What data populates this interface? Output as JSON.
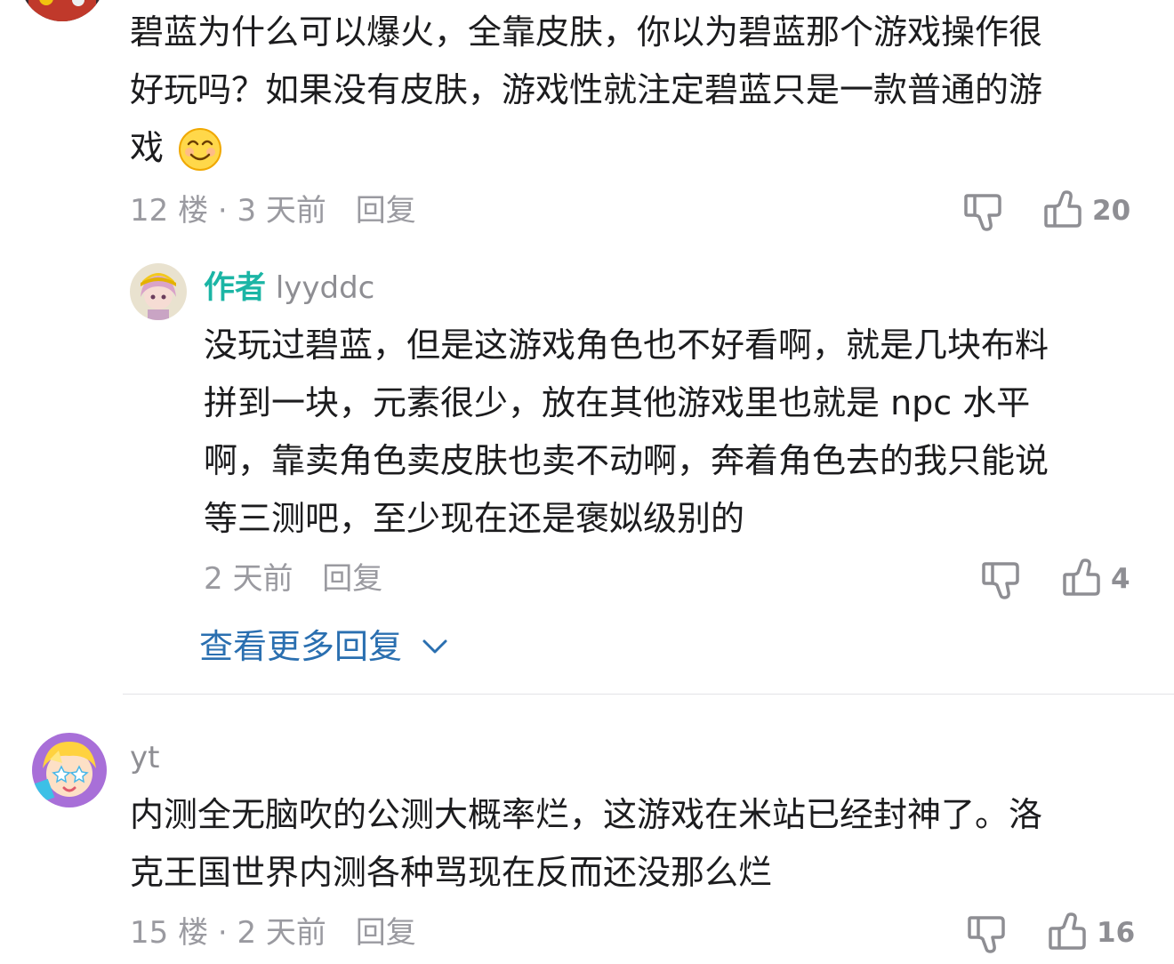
{
  "comment12": {
    "line1": "碧蓝为什么可以爆火，全靠皮肤，你以为碧蓝那个游戏操作很",
    "line2": "好玩吗？如果没有皮肤，游戏性就注定碧蓝只是一款普通的游",
    "line3": "戏",
    "emoji_icon": "grinning-face-emoji",
    "meta": "12 楼 · 3 天前",
    "reply_label": "回复",
    "likes": "20"
  },
  "author_reply": {
    "tag": "作者",
    "username": "lyyddc",
    "line1": "没玩过碧蓝，但是这游戏角色也不好看啊，就是几块布料",
    "line2": "拼到一块，元素很少，放在其他游戏里也就是 npc 水平",
    "line3": "啊，靠卖角色卖皮肤也卖不动啊，奔着角色去的我只能说",
    "line4": "等三测吧，至少现在还是褒姒级别的",
    "meta": "2 天前",
    "reply_label": "回复",
    "likes": "4"
  },
  "more_replies": {
    "label": "查看更多回复"
  },
  "comment15": {
    "username": "yt",
    "line1": "内测全无脑吹的公测大概率烂，这游戏在米站已经封神了。洛",
    "line2": "克王国世界内测各种骂现在反而还没那么烂",
    "meta": "15 楼 · 2 天前",
    "reply_label": "回复",
    "likes": "16"
  },
  "colors": {
    "author_tag": "#1bb5a5",
    "link": "#2a6fb0",
    "meta": "#9a9aa0",
    "text": "#1c1c1e"
  }
}
